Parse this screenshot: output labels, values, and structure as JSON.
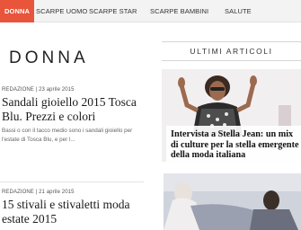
{
  "nav": {
    "items": [
      "DONNA",
      "SCARPE UOMO",
      "SCARPE STAR",
      "SCARPE BAMBINI",
      "SALUTE"
    ]
  },
  "section": {
    "title": "DONNA"
  },
  "articles": [
    {
      "meta": "REDAZIONE | 23 aprile 2015",
      "title": "Sandali gioiello 2015 Tosca Blu. Prezzi e colori",
      "excerpt": "Bassi o con il tacco medio sono i sandali gioiello per l'estate di Tosca Blu, e per l..."
    },
    {
      "meta": "REDAZIONE | 21 aprile 2015",
      "title": "15 stivali e stivaletti moda estate 2015",
      "excerpt": ""
    }
  ],
  "sidebar": {
    "heading": "ULTIMI ARTICOLI",
    "featured_caption": "Intervista a Stella Jean: un mix di culture per la stella emergente della moda italiana"
  },
  "colors": {
    "accent": "#e8553a",
    "nav_bg": "#f3f3f3"
  }
}
